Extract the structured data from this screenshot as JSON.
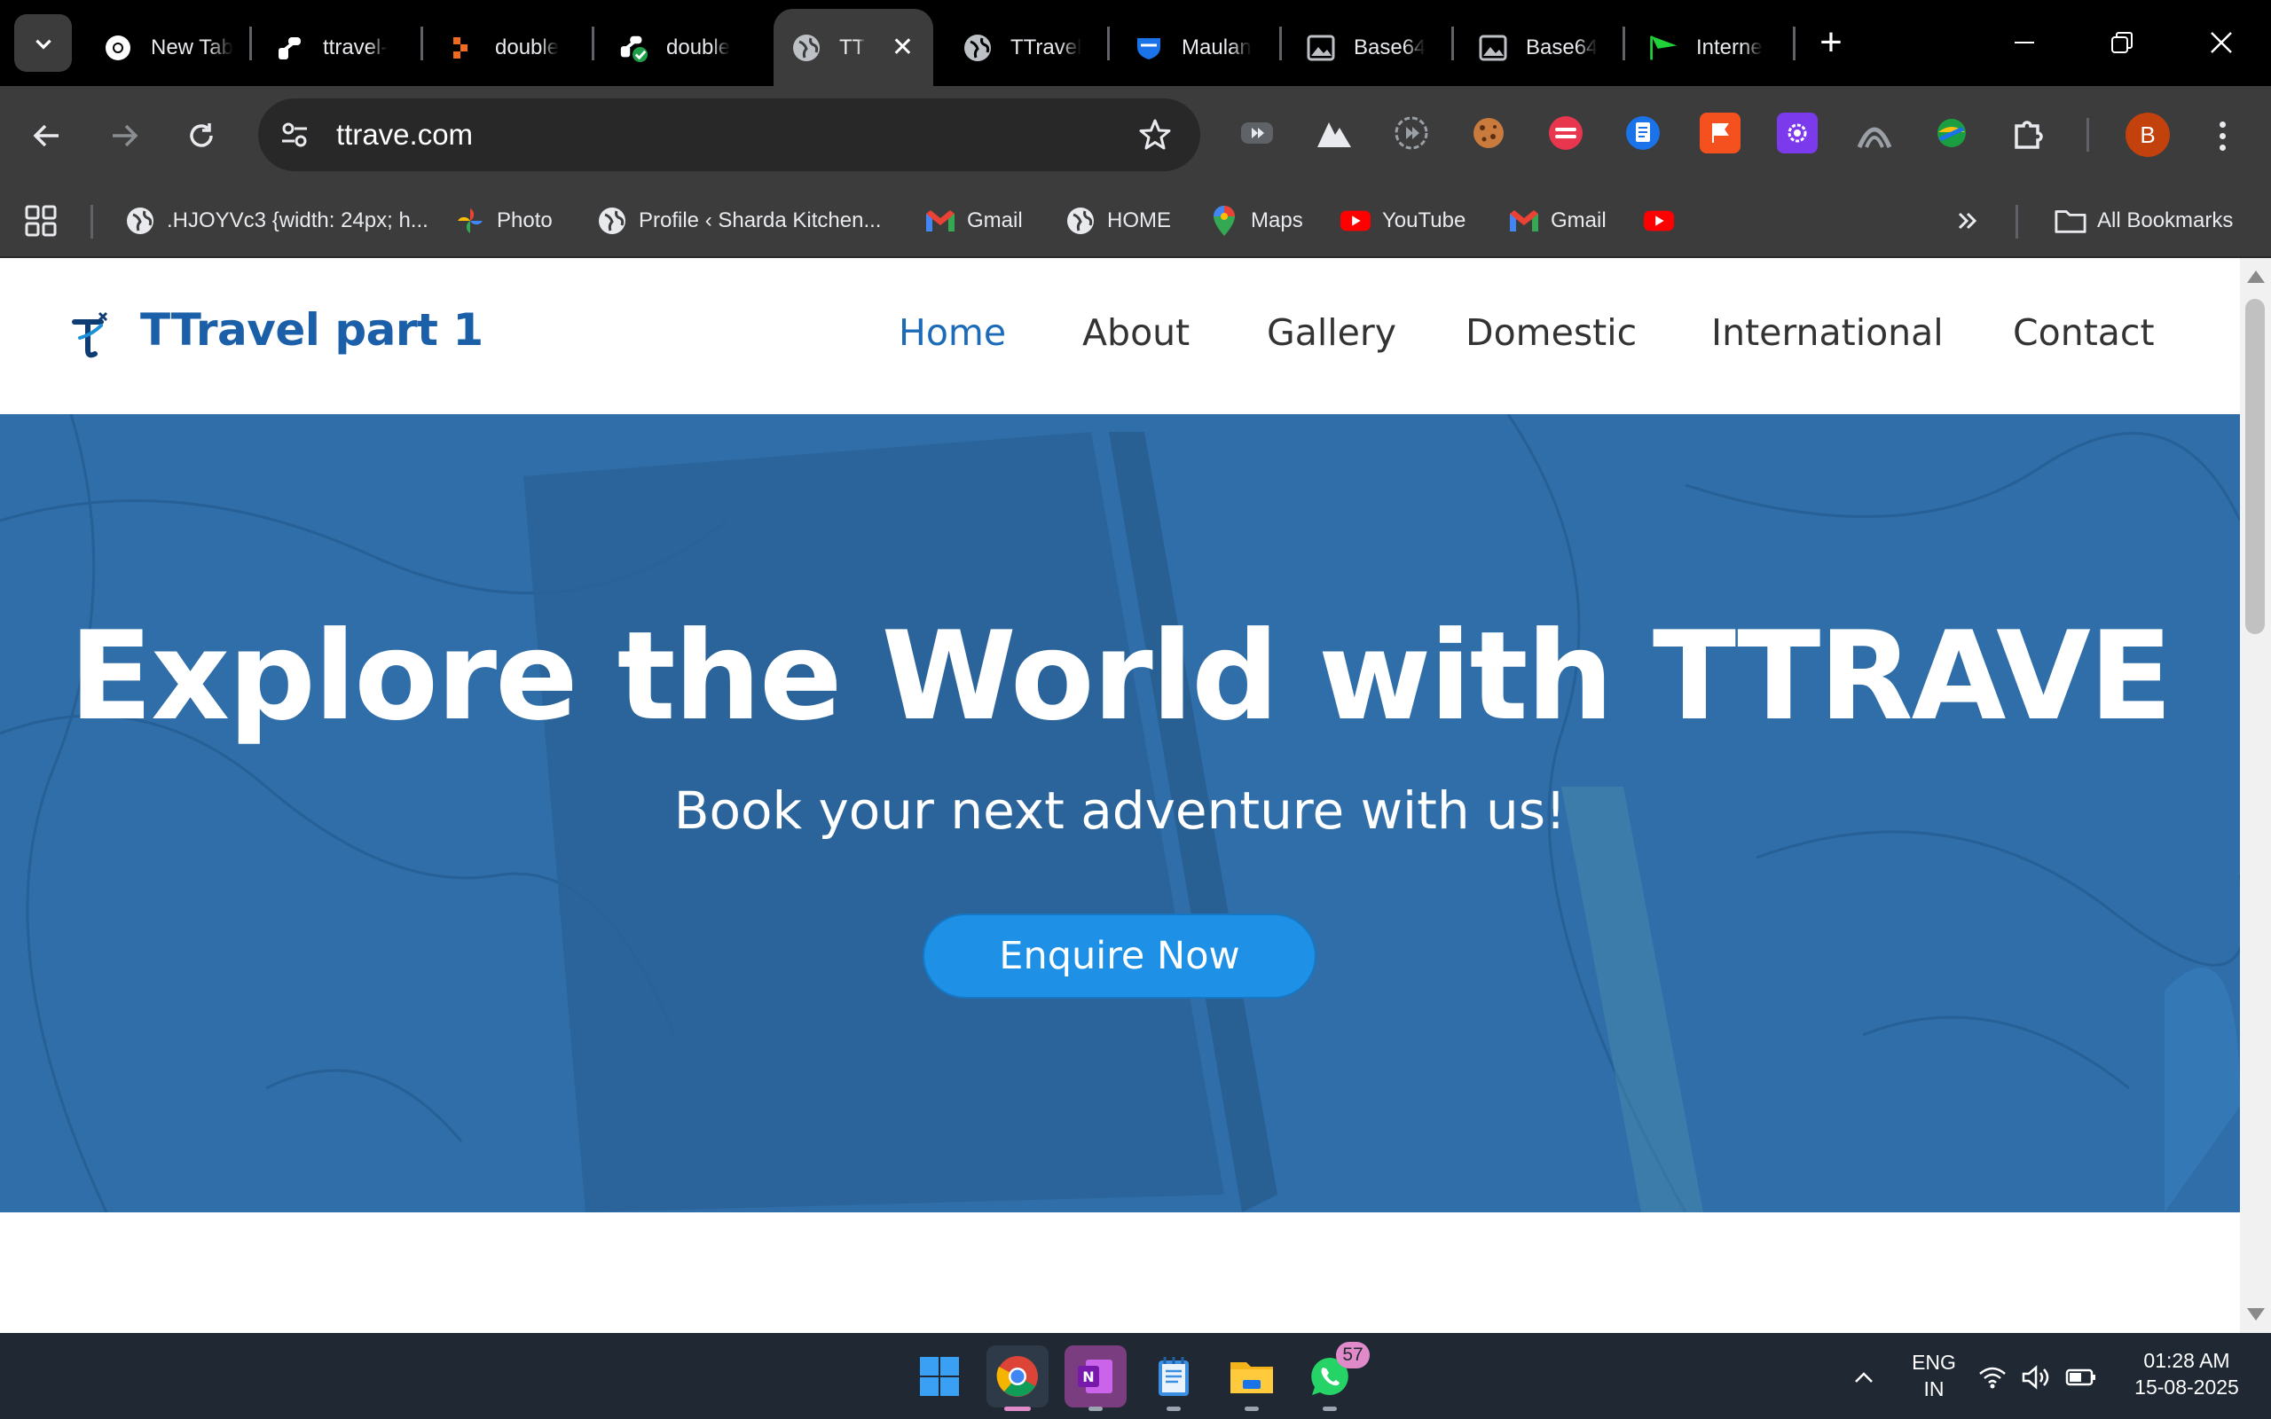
{
  "browser": {
    "tabs": [
      {
        "label": "New Tab",
        "icon": "chrome-icon"
      },
      {
        "label": "ttravel-",
        "icon": "link-icon"
      },
      {
        "label": "double",
        "icon": "orange-grid-icon"
      },
      {
        "label": "double",
        "icon": "link-check-icon"
      },
      {
        "label": "TT",
        "icon": "globe-icon",
        "active": true
      },
      {
        "label": "TTravel",
        "icon": "globe-icon"
      },
      {
        "label": "Maulan",
        "icon": "blue-shield-icon"
      },
      {
        "label": "Base64",
        "icon": "image-icon"
      },
      {
        "label": "Base64",
        "icon": "image-icon"
      },
      {
        "label": "Interne",
        "icon": "green-flag-icon"
      }
    ],
    "url": "ttrave.com",
    "bookmarks": [
      {
        "label": ".HJOYVc3 {width: 24px; h...",
        "icon": "globe-icon"
      },
      {
        "label": "Photo",
        "icon": "pinwheel-icon"
      },
      {
        "label": "Profile ‹ Sharda Kitchen...",
        "icon": "globe-icon"
      },
      {
        "label": "Gmail",
        "icon": "gmail-icon"
      },
      {
        "label": "HOME",
        "icon": "globe-icon"
      },
      {
        "label": "Maps",
        "icon": "maps-pin-icon"
      },
      {
        "label": "YouTube",
        "icon": "youtube-icon"
      },
      {
        "label": "Gmail",
        "icon": "gmail-icon"
      },
      {
        "label": "",
        "icon": "youtube-icon"
      }
    ],
    "all_bookmarks_label": "All Bookmarks",
    "profile_initial": "B"
  },
  "site": {
    "logo_text": "TTravel part 1",
    "nav": [
      "Home",
      "About",
      "Gallery",
      "Domestic",
      "International",
      "Contact"
    ],
    "active_nav": "Home",
    "hero_title": "Explore the World with TTRAVE",
    "hero_subtitle": "Book your next adventure with us!",
    "cta_label": "Enquire Now",
    "brand_color": "#1b5fa8",
    "hero_overlay_color": "#2b6aa6",
    "cta_color": "#1e90e6"
  },
  "taskbar": {
    "whatsapp_badge": "57",
    "lang_line1": "ENG",
    "lang_line2": "IN",
    "time": "01:28 AM",
    "date": "15-08-2025"
  }
}
